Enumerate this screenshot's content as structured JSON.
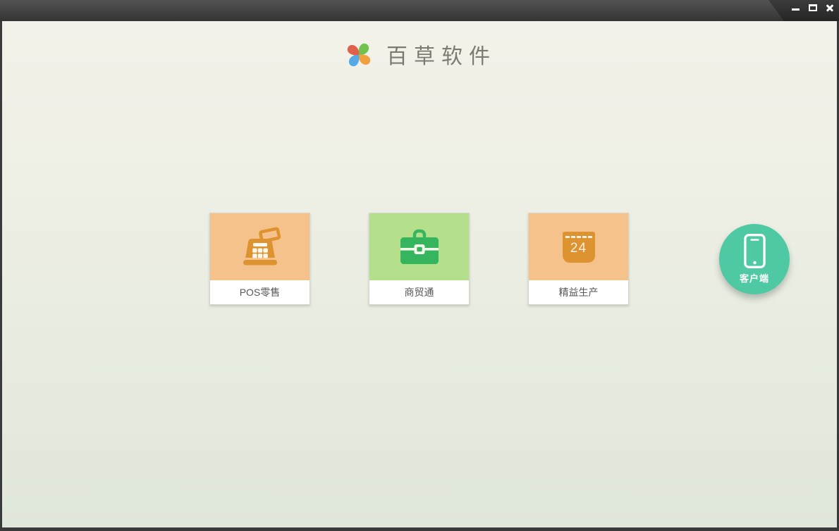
{
  "window": {
    "controls": [
      {
        "name": "minimize"
      },
      {
        "name": "maximize"
      },
      {
        "name": "close"
      }
    ]
  },
  "header": {
    "app_title": "百草软件",
    "logo_icon": "pinwheel-logo-icon",
    "logo_colors": {
      "top": "#72c24e",
      "right": "#f0a23f",
      "bottom": "#55a9e6",
      "left": "#e0604c"
    }
  },
  "products": [
    {
      "label": "POS零售",
      "icon": "cash-register-icon",
      "card_color": "#f6c28b",
      "icon_color": "#dd9330"
    },
    {
      "label": "商贸通",
      "icon": "briefcase-icon",
      "card_color": "#b4e08c",
      "icon_color": "#35b55e"
    },
    {
      "label": "精益生产",
      "icon": "calendar-24-icon",
      "card_color": "#f6c28b",
      "icon_color": "#dd9330",
      "calendar_day": "24"
    }
  ],
  "client": {
    "label": "客户端",
    "icon": "smartphone-icon",
    "bg": "#4fc9a3"
  },
  "colors": {
    "titlebar": "#424242",
    "frame_border": "#3a3a3a",
    "background_top": "#f3f2ea",
    "background_bottom": "#dfe7da"
  }
}
